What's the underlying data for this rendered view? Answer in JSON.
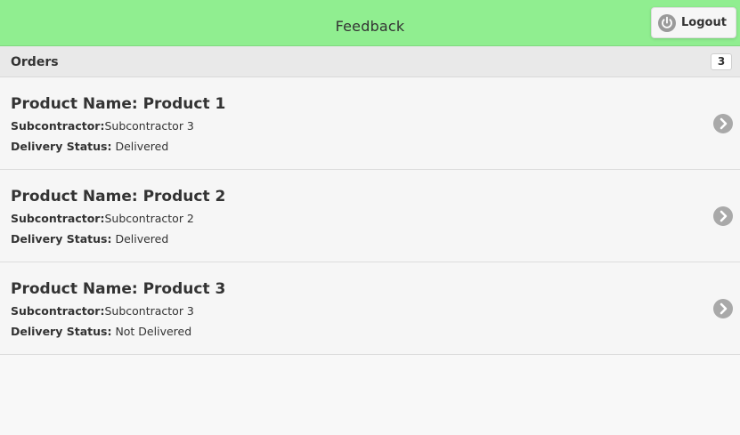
{
  "header": {
    "title": "Feedback",
    "logout_label": "Logout"
  },
  "orders": {
    "heading": "Orders",
    "count": "3",
    "items": [
      {
        "title": "Product Name: Product 1",
        "subcontractor_label": "Subcontractor:",
        "subcontractor_value": "Subcontractor 3",
        "status_label": "Delivery Status:",
        "status_value": "Delivered"
      },
      {
        "title": "Product Name: Product 2",
        "subcontractor_label": "Subcontractor:",
        "subcontractor_value": "Subcontractor 2",
        "status_label": "Delivery Status:",
        "status_value": "Delivered"
      },
      {
        "title": "Product Name: Product 3",
        "subcontractor_label": "Subcontractor:",
        "subcontractor_value": "Subcontractor 3",
        "status_label": "Delivery Status:",
        "status_value": "Not Delivered"
      }
    ]
  },
  "icons": {
    "logout": "power-icon",
    "item_arrow": "chevron-right-icon"
  },
  "colors": {
    "header_bg": "#90ee90",
    "divider_bg": "#e9e9e9",
    "list_bg": "#f6f6f6",
    "icon_gray": "#a9a9a9"
  }
}
